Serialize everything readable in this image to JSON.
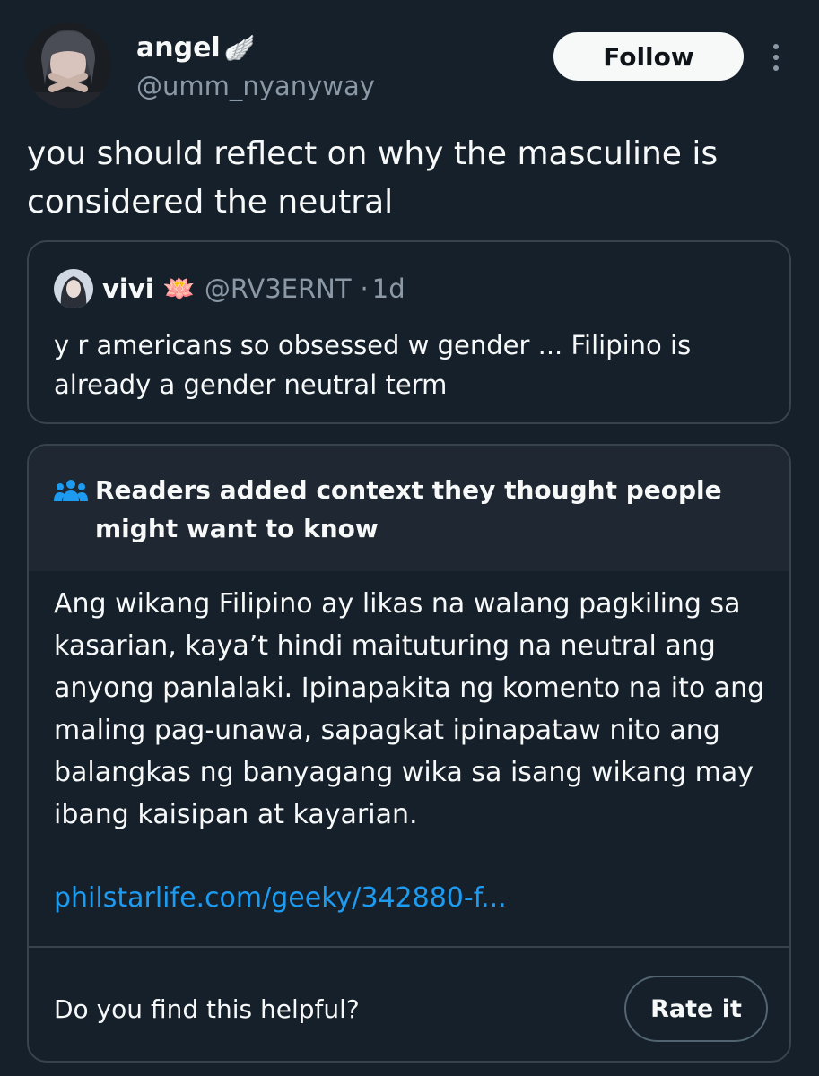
{
  "author": {
    "display_name": "angel",
    "name_emoji": "🪽",
    "handle": "@umm_nyanyway",
    "avatar_icon": "user-avatar-photo"
  },
  "actions": {
    "follow_label": "Follow",
    "more_icon": "more-vertical-icon"
  },
  "tweet": {
    "text": "you should reflect on why the masculine is considered the neutral"
  },
  "quoted_tweet": {
    "display_name": "vivi",
    "name_emoji": "🪷",
    "handle": "@RV3ERNT",
    "separator": "·",
    "time": "1d",
    "text": "y r americans so obsessed w gender ... Filipino is already a gender neutral term"
  },
  "community_note": {
    "icon": "people-icon",
    "title": "Readers added context they thought people might want to know",
    "body": "Ang wikang Filipino ay likas na walang pagkiling sa kasarian, kaya’t hindi maituturing na neutral ang anyong panlalaki. Ipinapakita ng komento na ito ang maling pag-unawa, sapagkat ipinapataw nito ang balangkas ng banyagang wika sa isang wikang may ibang kaisipan at kayarian.",
    "link_text": "philstarlife.com/geeky/342880-f...",
    "helpful_question": "Do you find this helpful?",
    "rate_label": "Rate it"
  },
  "colors": {
    "background": "#15202b",
    "note_header_bg": "#1e2732",
    "border": "#38444d",
    "text_primary": "#f7f9f9",
    "text_secondary": "#8b98a5",
    "link": "#1d9bf0"
  }
}
